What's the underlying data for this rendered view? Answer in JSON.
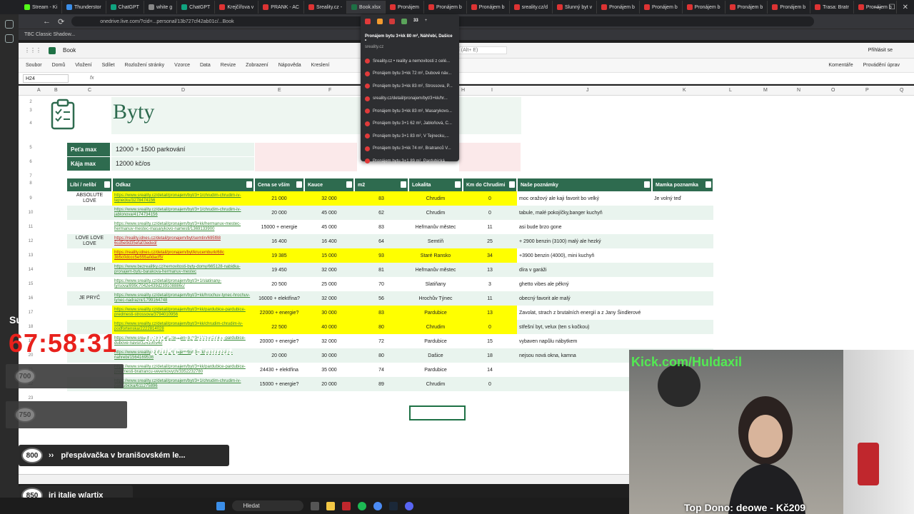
{
  "browser": {
    "tabs": [
      "Stream - Ki",
      "Thunderstor",
      "ChatGPT",
      "white g",
      "ChatGPT",
      "Krejčířova v",
      "PRANK - AC",
      "Sreality.cz -",
      "Book.xlsx",
      "Pronájem",
      "Pronájem b",
      "Pronájem b",
      "sreality.cz/d",
      "Slunný byt v",
      "Pronájem b",
      "Pronájem b",
      "Pronájem b",
      "Pronájem b",
      "Pronájem b",
      "Trasa: Bratr",
      "Pronájem b"
    ],
    "url": "onedrive.live.com/?cid=...personal/13b727cf42ab01c/...Book",
    "bookmark": "TBC Classic Shadow..."
  },
  "tab_dropdown": {
    "icon_count": "33",
    "header_title": "Pronájem bytu 3+kk 80 m², Náhřebí, Dašice •",
    "header_site": "sreality.cz",
    "items": [
      "Sreality.cz • reality a nemovitosti z celé...",
      "Pronájem bytu 3+kk 72 m², Dubové náv...",
      "Pronájem bytu 3+kk 83 m², Strossova, P...",
      "sreality.cz/detail/pronajem/byt/3+kk/hr...",
      "Pronájem bytu 3+kk 83 m², Masarykovo...",
      "Pronájem bytu 3+1 62 m², Jabloňová, C...",
      "Pronájem bytu 3+1 83 m², V Tejnecku,...",
      "Pronájem bytu 3+kk 74 m², Bratranců V...",
      "Pronájem bytu 3+1 89 m², Pardubická..."
    ]
  },
  "excel": {
    "file_name": "Book",
    "search_hint": "a další (Alt+ E)",
    "signin": "Přihlásit se",
    "menu": [
      "Soubor",
      "Domů",
      "Vložení",
      "Sdílet",
      "Rozložení stránky",
      "Vzorce",
      "Data",
      "Revize",
      "Zobrazení",
      "Nápověda",
      "Kreslení"
    ],
    "comments": "Komentáře",
    "editing": "Provádění úprav",
    "namebox": "H24",
    "columns": [
      "A",
      "B",
      "C",
      "D",
      "E",
      "F",
      "G",
      "H",
      "I",
      "J",
      "K",
      "L",
      "M",
      "N",
      "O",
      "P",
      "Q"
    ],
    "rows": [
      "2",
      "3",
      "4",
      "5",
      "6",
      "7",
      "8",
      "9",
      "10",
      "11",
      "12",
      "13",
      "14",
      "15",
      "16",
      "17",
      "18",
      "19",
      "20",
      "21",
      "22",
      "23"
    ]
  },
  "sheet": {
    "title": "Byty",
    "limits": [
      {
        "label": "Peťa max",
        "value": "12000 + 1500 parkování"
      },
      {
        "label": "Kája max",
        "value": "12000 kč/os"
      }
    ],
    "headers": [
      "Líbí / nelíbí",
      "Odkaz",
      "Cena se vším",
      "Kauce",
      "m2",
      "Lokalita",
      "Km do Chrudimi",
      "Naše poznámky",
      "Mamka poznamka"
    ],
    "rows": [
      {
        "like": "ABSOLUTE LOVE",
        "link": "https://www.sreality.cz/detail/pronajem/byt/3+1/chrudim-chrudim-iv-tejnecku/3278474156",
        "price": "21 000",
        "deposit": "32 000",
        "m2": "83",
        "loc": "Chrudim",
        "km": "0",
        "note": "moc oražový ale kaji favorit bo velký",
        "mom": "Je volný teď",
        "hl": true
      },
      {
        "like": "",
        "link": "https://www.sreality.cz/detail/pronajem/byt/3+1/chrudim-chrudim-iv-jablonova/4174734156",
        "price": "20 000",
        "deposit": "45 000",
        "m2": "62",
        "loc": "Chrudim",
        "km": "0",
        "note": "tabule, malé pokojíčky,banger kuchyň",
        "mom": "",
        "hl": false
      },
      {
        "like": "",
        "link": "https://www.sreality.cz/detail/pronajem/byt/3+kk/hermanuv-mestec-hermanuv-mestec-masarykovo-namesti/1369133900",
        "price": "15000 + energie",
        "deposit": "45 000",
        "m2": "83",
        "loc": "Heřmanův městec",
        "km": "11",
        "note": "asi bude brzo gone",
        "mom": "",
        "hl": false
      },
      {
        "like": "LOVE LOVE LOVE",
        "link": "https://reality.idnes.cz/detail/pronajem/byt/semtin/695f88 6cd5e9d35efa03eded/",
        "price": "16 400",
        "deposit": "16 400",
        "m2": "64",
        "loc": "Semtíň",
        "km": "25",
        "note": "+ 2900 benzin (3100) malý ale hezký",
        "mom": "",
        "hl": false
      },
      {
        "like": "",
        "link": "https://reality.idnes.cz/detail/pronajem/byt/krucemburk/68c 3b5c0dccc5e555a0dacf5/",
        "price": "19 385",
        "deposit": "15 000",
        "m2": "93",
        "loc": "Staré Ransko",
        "km": "34",
        "note": "+3900 benzin (4000), mini kuchyň",
        "mom": "",
        "hl": true
      },
      {
        "like": "MEH",
        "link": "https://www.bezrealitky.cz/nemovitosti-byty-domy/665128-nabidka-pronajem-bytu-barakova-hermanuv-mestec",
        "price": "19 450",
        "deposit": "32 000",
        "m2": "81",
        "loc": "Heřmanův městec",
        "km": "13",
        "note": "díra v garáži",
        "mom": "",
        "hl": false
      },
      {
        "like": "",
        "link": "https://www.sreality.cz/detail/pronajem/byt/3+1/slatinany-tyrsova/899c7042e439d239108886c/",
        "price": "20 500",
        "deposit": "25 000",
        "m2": "70",
        "loc": "Slatiňany",
        "km": "3",
        "note": "ghetto vibes ale pěkný",
        "mom": "",
        "hl": false
      },
      {
        "like": "JE PRYČ",
        "link": "https://www.sreality.cz/detail/pronajem/byt/3+kk/hrochuv-tynec-hrochuv-tynec-nadrazni/1799164748",
        "price": "16000 + elektřina?",
        "deposit": "32 000",
        "m2": "56",
        "loc": "Hrochův Týnec",
        "km": "11",
        "note": "obecný favorit ale malý",
        "mom": "",
        "hl": false
      },
      {
        "like": "",
        "link": "https://www.sreality.cz/detail/pronajem/byt/3+kk/pardubice-pardubice-predmesti-strossova/3794010956",
        "price": "22000 + energie?",
        "deposit": "30 000",
        "m2": "83",
        "loc": "Pardubice",
        "km": "13",
        "note": "Zavolat, strach z brutalních energií a z Jany Šindlerové",
        "mom": "",
        "hl": true
      },
      {
        "like": "",
        "link": "https://www.sreality.cz/detail/pronajem/byt/3+kk/chrudim-chrudim-iv-podfortenska/2222814028",
        "price": "22 500",
        "deposit": "40 000",
        "m2": "80",
        "loc": "Chrudim",
        "km": "0",
        "note": "střešní byt, velux (ten s kočkou)",
        "mom": "",
        "hl": true
      },
      {
        "like": "",
        "link": "https://www.sreality.cz/detail/pronajem/byt/3+kk/pardubice-pardubice-dubove-navsi/324100940",
        "price": "20000 + energie?",
        "deposit": "32 000",
        "m2": "72",
        "loc": "Pardubice",
        "km": "15",
        "note": "vybaven napůlu nábytkem",
        "mom": "",
        "hl": false
      },
      {
        "like": "",
        "link": "https://www.sreality.cz/detail/pronajem/byt/3+kk/dasice-dasice-nahrebi/1564169536",
        "price": "20 000",
        "deposit": "30 000",
        "m2": "80",
        "loc": "Dašice",
        "km": "18",
        "note": "nejsou nová okna, kamna",
        "mom": "",
        "hl": false
      },
      {
        "like": "",
        "link": "https://www.sreality.cz/detail/pronajem/byt/3+kk/pardubice-pardubice-predmesti-bratrancu-veverkovych/3352232780",
        "price": "24430 + elektřina",
        "deposit": "35 000",
        "m2": "74",
        "loc": "Pardubice",
        "km": "14",
        "note": "",
        "mom": "",
        "hl": false
      },
      {
        "like": "",
        "link": "https://www.sreality.cz/detail/pronajem/byt/3+1/chrudim-chrudim-iv-pardubicka/611275896",
        "price": "15000 + energie?",
        "deposit": "20 000",
        "m2": "89",
        "loc": "Chrudim",
        "km": "0",
        "note": "",
        "mom": "",
        "hl": false
      }
    ]
  },
  "stream": {
    "subs_label": "Subs: 731",
    "timer": "67:58:31",
    "donation_1": "100Kč = 15 minut",
    "donation_2": "100Kč = 15 minut",
    "goal_1_points": "800",
    "goal_1_text": "přespávačka v branišovském le...",
    "goal_2_points": "850",
    "goal_2_text": "iri italie w/artix",
    "blurred_1": "700",
    "blurred_2": "750",
    "kick": "Kick.com/Huldaxil",
    "top_dono": "Top Dono: deowe - Kč209"
  },
  "taskbar": {
    "search": "Hledat"
  },
  "colors": {
    "accent_green": "#2e6b4f",
    "highlight_yellow": "#ffff00",
    "timer_red": "#e8211c",
    "kick_green": "#4dff4d"
  }
}
